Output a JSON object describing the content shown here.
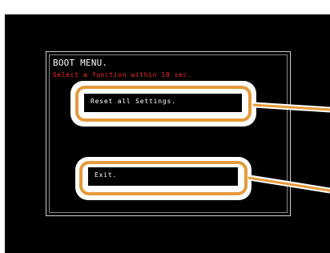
{
  "menu": {
    "title": "BOOT MENU.",
    "subtitle": "Select a function within 10 sec.",
    "options": [
      {
        "label": "Reset all Settings."
      },
      {
        "label": "Exit."
      }
    ]
  },
  "colors": {
    "screen": "#000000",
    "title": "#ffffff",
    "subtitle": "#ff2a2a",
    "highlight": "#e69a3c"
  }
}
